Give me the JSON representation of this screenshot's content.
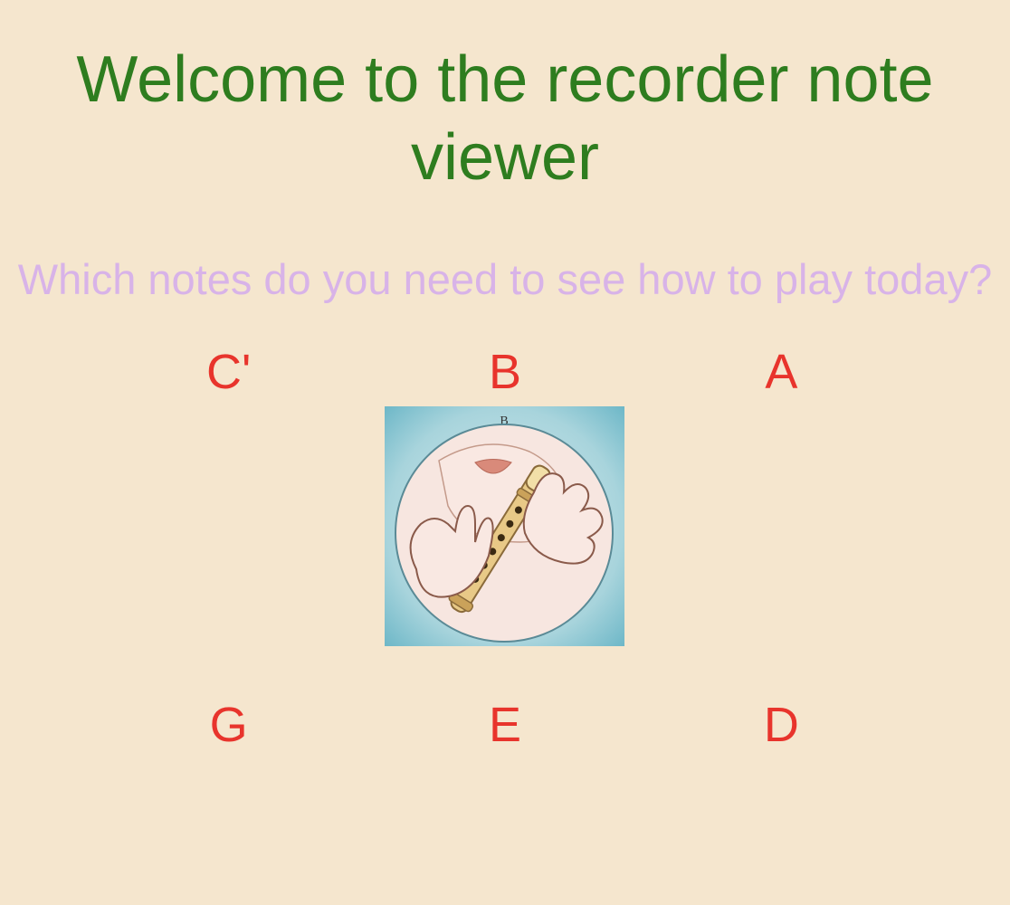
{
  "title": "Welcome to the recorder note viewer",
  "subtitle": "Which notes do you need to see how to play today?",
  "notes": {
    "row1": [
      {
        "label": "C'",
        "showImage": false
      },
      {
        "label": "B",
        "showImage": true,
        "imageNoteLabel": "B"
      },
      {
        "label": "A",
        "showImage": false
      }
    ],
    "row2": [
      {
        "label": "G",
        "showImage": false
      },
      {
        "label": "E",
        "showImage": false
      },
      {
        "label": "D",
        "showImage": false
      }
    ]
  }
}
